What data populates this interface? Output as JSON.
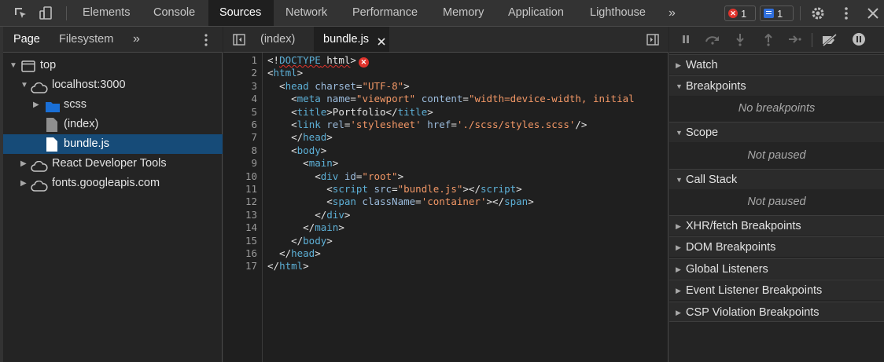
{
  "toolbar": {
    "tabs": [
      "Elements",
      "Console",
      "Sources",
      "Network",
      "Performance",
      "Memory",
      "Application",
      "Lighthouse"
    ],
    "active_tab": "Sources",
    "more": "»",
    "error_count": "1",
    "message_count": "1"
  },
  "navigator": {
    "tabs": [
      "Page",
      "Filesystem"
    ],
    "more": "»",
    "tree": [
      {
        "label": "top",
        "icon": "frame-icon"
      },
      {
        "label": "localhost:3000",
        "icon": "cloud-icon"
      },
      {
        "label": "scss",
        "icon": "folder-icon"
      },
      {
        "label": "(index)",
        "icon": "file-icon"
      },
      {
        "label": "bundle.js",
        "icon": "file-icon"
      },
      {
        "label": "React Developer Tools",
        "icon": "cloud-icon"
      },
      {
        "label": "fonts.googleapis.com",
        "icon": "cloud-icon"
      }
    ]
  },
  "editor": {
    "tabs": [
      "(index)",
      "bundle.js"
    ],
    "line_numbers": [
      "1",
      "2",
      "3",
      "4",
      "5",
      "6",
      "7",
      "8",
      "9",
      "10",
      "11",
      "12",
      "13",
      "14",
      "15",
      "16",
      "17"
    ]
  },
  "debugger": {
    "sections": {
      "watch": "Watch",
      "breakpoints": "Breakpoints",
      "breakpoints_empty": "No breakpoints",
      "scope": "Scope",
      "scope_empty": "Not paused",
      "callstack": "Call Stack",
      "callstack_empty": "Not paused",
      "xhr": "XHR/fetch Breakpoints",
      "dom": "DOM Breakpoints",
      "global": "Global Listeners",
      "event": "Event Listener Breakpoints",
      "csp": "CSP Violation Breakpoints"
    }
  },
  "colors": {
    "selected_row": "#164b78",
    "error_red": "#e0332c",
    "message_blue": "#2f6fde",
    "tag": "#5db0d7",
    "string": "#f29766"
  }
}
